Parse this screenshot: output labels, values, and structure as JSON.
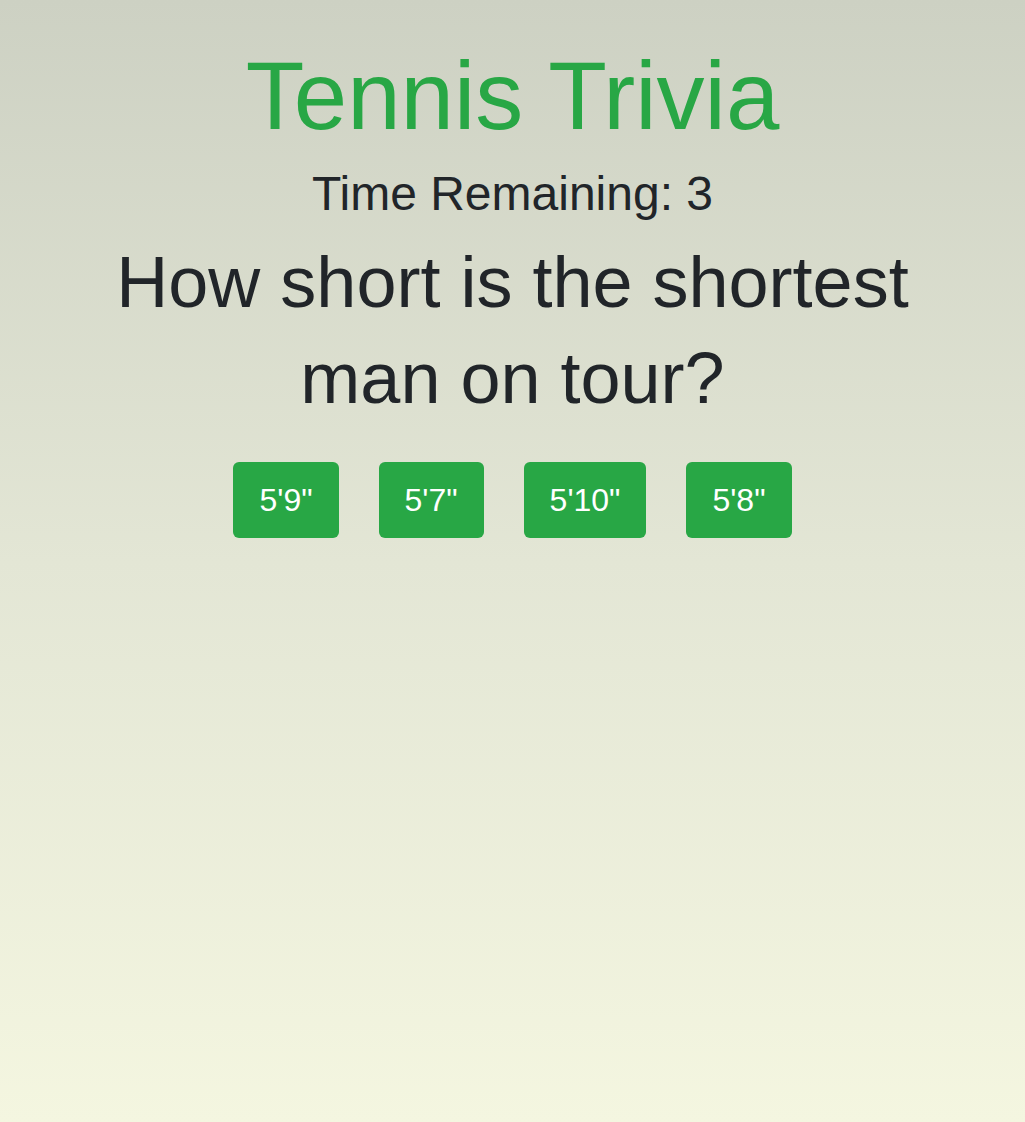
{
  "title": "Tennis Trivia",
  "timer": "Time Remaining: 3",
  "question": "How short is the shortest man on tour?",
  "answers": [
    {
      "label": "5'9\""
    },
    {
      "label": "5'7\""
    },
    {
      "label": "5'10\""
    },
    {
      "label": "5'8\""
    }
  ]
}
